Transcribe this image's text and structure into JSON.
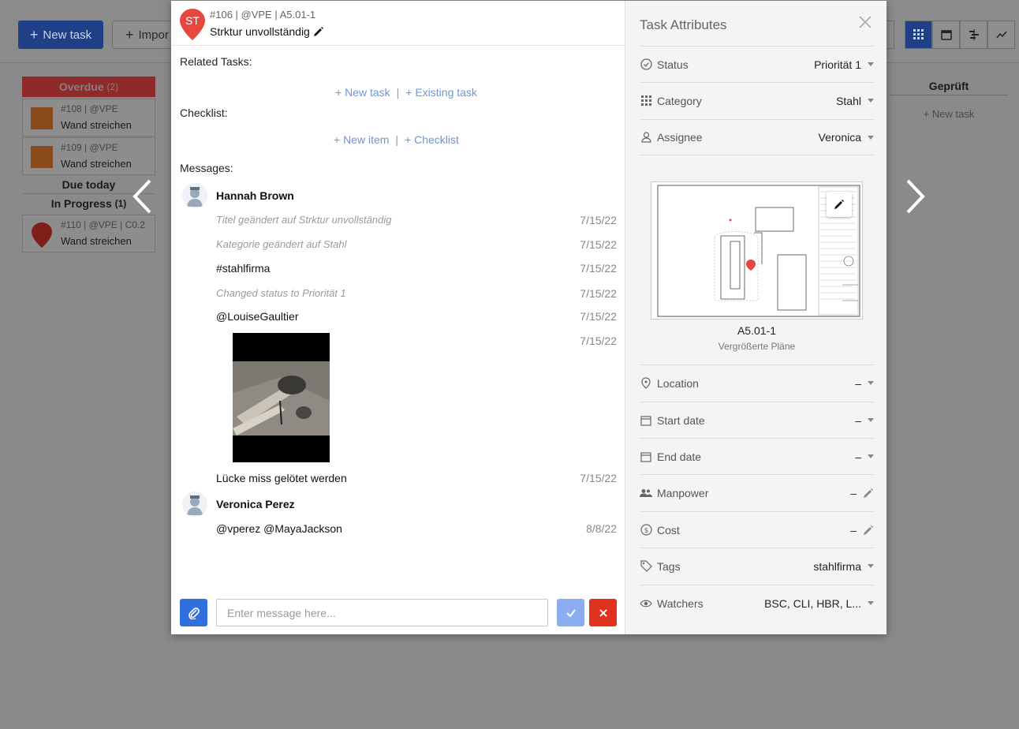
{
  "background": {
    "new_task_label": "New task",
    "import_label": "Impor",
    "columns": {
      "overdue_label": "Overdue",
      "overdue_count": "(2)",
      "due_today_label": "Due today",
      "in_progress_label": "In Progress",
      "in_progress_count": "(1)",
      "cards": [
        {
          "meta": "#108 | @VPE",
          "title": "Wand streichen"
        },
        {
          "meta": "#109 | @VPE",
          "title": "Wand streichen"
        },
        {
          "meta": "#110 | @VPE | C0.2",
          "title": "Wand streichen"
        }
      ],
      "geprueft_label": "Geprüft",
      "geprueft_new_task": "+ New task"
    }
  },
  "task": {
    "initials": "ST",
    "meta": "#106 | @VPE | A5.01-1",
    "title": "Strktur unvollständig",
    "related_tasks_label": "Related Tasks:",
    "new_task_link": "+ New task",
    "existing_task_link": "+ Existing task",
    "checklist_label": "Checklist:",
    "new_item_link": "+ New item",
    "checklist_link": "+ Checklist",
    "messages_label": "Messages:",
    "messages": [
      {
        "author": "Hannah Brown",
        "entries": [
          {
            "text": "Titel geändert auf Strktur unvollständig",
            "date": "7/15/22",
            "system": true
          },
          {
            "text": "Kategorie geändert auf Stahl",
            "date": "7/15/22",
            "system": true
          },
          {
            "text": "#stahlfirma",
            "date": "7/15/22",
            "system": false
          },
          {
            "text": "Changed status to Priorität 1",
            "date": "7/15/22",
            "system": true
          },
          {
            "text": "@LouiseGaultier",
            "date": "7/15/22",
            "system": false
          },
          {
            "text": "",
            "date": "7/15/22",
            "system": false
          },
          {
            "text": "Lücke miss gelötet werden",
            "date": "7/15/22",
            "system": false
          }
        ]
      },
      {
        "author": "Veronica Perez",
        "entries": [
          {
            "text": "@vperez @MayaJackson",
            "date": "8/8/22",
            "system": false
          }
        ]
      }
    ],
    "message_placeholder": "Enter message here..."
  },
  "attributes": {
    "title": "Task Attributes",
    "status": {
      "label": "Status",
      "value": "Priorität 1"
    },
    "category": {
      "label": "Category",
      "value": "Stahl"
    },
    "assignee": {
      "label": "Assignee",
      "value": "Veronica"
    },
    "plan": {
      "name": "A5.01-1",
      "subtitle": "Vergrößerte Pläne"
    },
    "location": {
      "label": "Location",
      "value": "–"
    },
    "start_date": {
      "label": "Start date",
      "value": "–"
    },
    "end_date": {
      "label": "End date",
      "value": "–"
    },
    "manpower": {
      "label": "Manpower",
      "value": "–"
    },
    "cost": {
      "label": "Cost",
      "value": "–"
    },
    "tags": {
      "label": "Tags",
      "value": "stahlfirma"
    },
    "watchers": {
      "label": "Watchers",
      "value": "BSC, CLI, HBR, L..."
    }
  },
  "colors": {
    "accent": "#2f6fde",
    "danger": "#e0321f",
    "pin": "#e8473f",
    "link": "#6f95d2"
  }
}
